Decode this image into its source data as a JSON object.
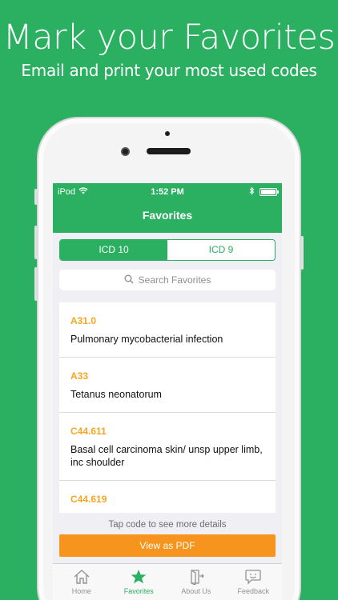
{
  "promo": {
    "headline": "Mark your Favorites",
    "subline": "Email and print your most used codes"
  },
  "status_bar": {
    "carrier": "iPod",
    "time": "1:52 PM",
    "icons": [
      "wifi-icon",
      "bluetooth-icon",
      "battery-icon"
    ]
  },
  "nav": {
    "title": "Favorites"
  },
  "segments": [
    {
      "label": "ICD 10",
      "selected": true
    },
    {
      "label": "ICD 9",
      "selected": false
    }
  ],
  "search": {
    "placeholder": "Search Favorites"
  },
  "favorites": [
    {
      "code": "A31.0",
      "description": "Pulmonary mycobacterial infection"
    },
    {
      "code": "A33",
      "description": "Tetanus neonatorum"
    },
    {
      "code": "C44.611",
      "description": "Basal cell carcinoma skin/ unsp upper limb, inc shoulder"
    },
    {
      "code": "C44.619",
      "description": ""
    }
  ],
  "footer": {
    "hint": "Tap code to see more details",
    "pdf_button": "View as PDF"
  },
  "tabs": [
    {
      "label": "Home",
      "icon": "home-icon",
      "active": false
    },
    {
      "label": "Favorites",
      "icon": "star-icon",
      "active": true
    },
    {
      "label": "About Us",
      "icon": "about-icon",
      "active": false
    },
    {
      "label": "Feedback",
      "icon": "feedback-icon",
      "active": false
    }
  ],
  "colors": {
    "brand_green": "#2bb062",
    "code_orange": "#f5a623",
    "button_orange": "#f7941d"
  }
}
